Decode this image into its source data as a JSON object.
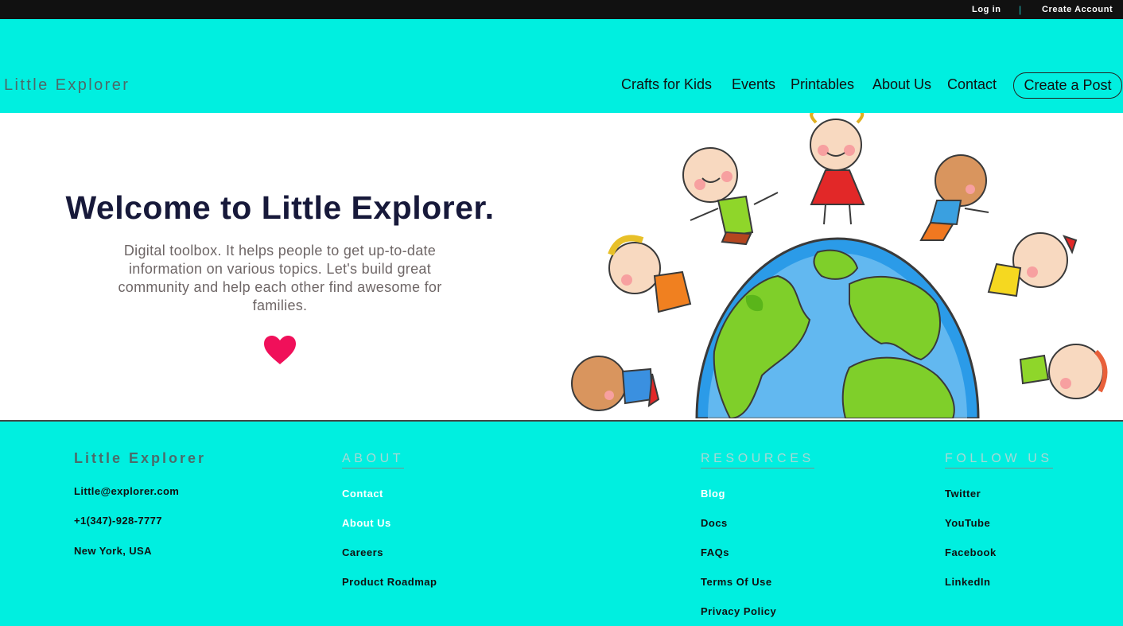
{
  "topbar": {
    "login": "Log in",
    "separator": "|",
    "create_account": "Create Account"
  },
  "header": {
    "brand": "Little Explorer",
    "nav": [
      "Crafts for Kids",
      "Events",
      "Printables",
      "About Us",
      "Contact"
    ],
    "cta": "Create a Post"
  },
  "hero": {
    "title": "Welcome to Little Explorer.",
    "text": "Digital toolbox. It helps people to get up-to-date information on various topics. Let's build great community and help each other find awesome for families.",
    "icon": "heart-icon",
    "image": "kids-around-globe-illustration"
  },
  "footer": {
    "brand": "Little Explorer",
    "contact": {
      "email": "Little@explorer.com",
      "phone": "+1(347)-928-7777",
      "location": "New York, USA"
    },
    "about": {
      "heading": "ABOUT",
      "links": [
        "Contact",
        "About Us",
        "Careers",
        "Product Roadmap"
      ]
    },
    "resources": {
      "heading": "RESOURCES",
      "links": [
        "Blog",
        "Docs",
        "FAQs",
        "Terms Of Use",
        "Privacy Policy"
      ]
    },
    "follow": {
      "heading": "FOLLOW US",
      "links": [
        "Twitter",
        "YouTube",
        "Facebook",
        "LinkedIn"
      ]
    }
  },
  "colors": {
    "accent": "#00efe0",
    "topbar": "#111111",
    "heart": "#f0105a",
    "title": "#17193a"
  }
}
